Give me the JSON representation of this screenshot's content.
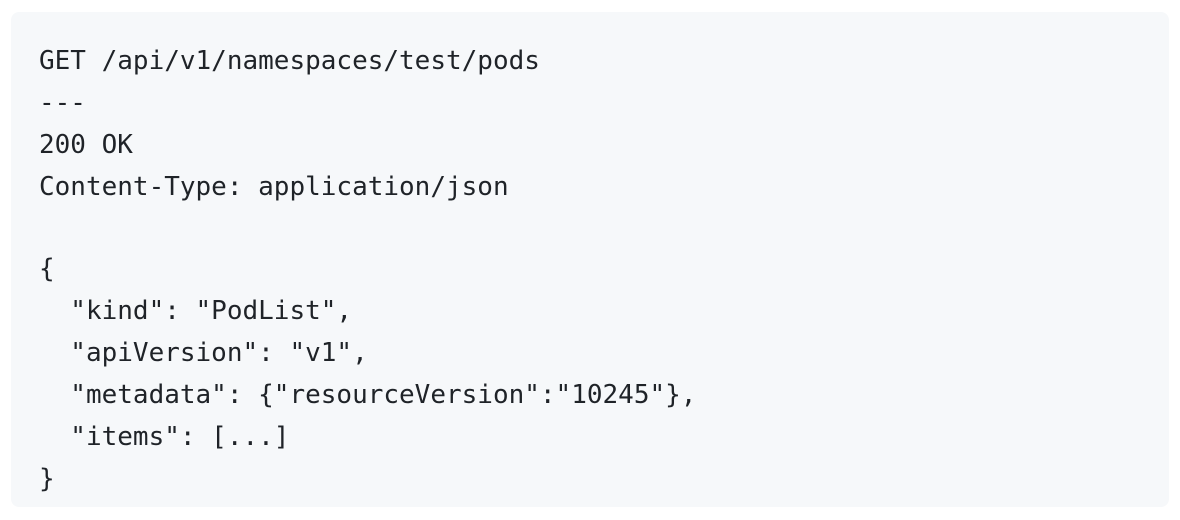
{
  "request": {
    "line": "GET /api/v1/namespaces/test/pods"
  },
  "separator": "---",
  "response": {
    "status": "200 OK",
    "content_type_header": "Content-Type: application/json"
  },
  "body": {
    "open_brace": "{",
    "kind_line": "  \"kind\": \"PodList\",",
    "api_version_line": "  \"apiVersion\": \"v1\",",
    "metadata_line": "  \"metadata\": {\"resourceVersion\":\"10245\"},",
    "items_line": "  \"items\": [...]",
    "close_brace": "}"
  }
}
